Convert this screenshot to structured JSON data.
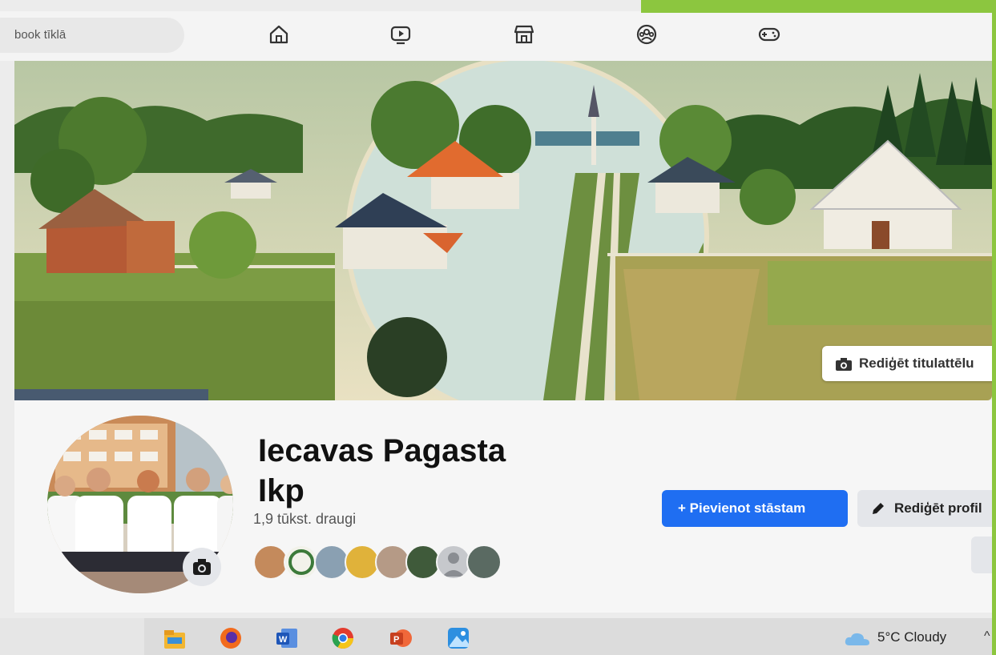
{
  "search": {
    "placeholder_text": "book tīklā"
  },
  "nav": {
    "items": [
      {
        "name": "home-icon"
      },
      {
        "name": "video-icon"
      },
      {
        "name": "marketplace-icon"
      },
      {
        "name": "groups-icon"
      },
      {
        "name": "gaming-icon"
      }
    ]
  },
  "cover": {
    "edit_label": "Rediģēt titulattēlu"
  },
  "profile": {
    "name_line1": "Iecavas Pagasta",
    "name_line2": "Ikp",
    "friends_count": "1,9 tūkst. draugi"
  },
  "actions": {
    "add_story_label": "+ Pievienot stāstam",
    "edit_profile_label": "Rediģēt profil"
  },
  "taskbar": {
    "weather_text": "5°C  Cloudy",
    "apps": [
      "file-explorer-icon",
      "firefox-icon",
      "word-icon",
      "chrome-icon",
      "powerpoint-icon",
      "photos-icon"
    ]
  },
  "colors": {
    "accent": "#1f6ef2",
    "green_frame": "#8cc63f"
  }
}
